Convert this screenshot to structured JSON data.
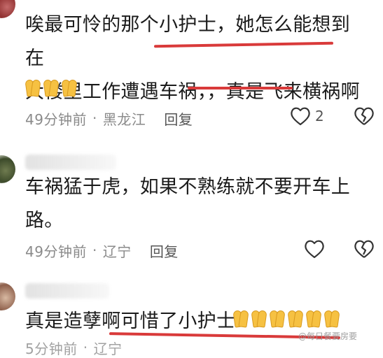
{
  "comments": [
    {
      "lines": [
        "唉最可怜的那个小护士，她怎么能想到在",
        "大楼里工作遭遇车祸，，真是飞来横祸啊"
      ],
      "emoji_count": 3,
      "time": "49分钟前",
      "location": "黑龙江",
      "reply_label": "回复",
      "like_count": "2"
    },
    {
      "lines": [
        "车祸猛于虎，如果不熟练就不要开车上",
        "路。"
      ],
      "time": "49分钟前",
      "location": "辽宁",
      "reply_label": "回复"
    },
    {
      "lines": [
        "真是造孽啊可惜了小护士"
      ],
      "emoji_count": 6,
      "time": "5分钟前",
      "location": "辽宁"
    }
  ],
  "watermark": "@每日餐要房要",
  "colors": {
    "underline": "#d93a3a",
    "meta": "#8a8a8a",
    "emoji": "#f6c142"
  },
  "icons": [
    "heart-icon",
    "broken-heart-icon",
    "pray-hands-emoji"
  ]
}
